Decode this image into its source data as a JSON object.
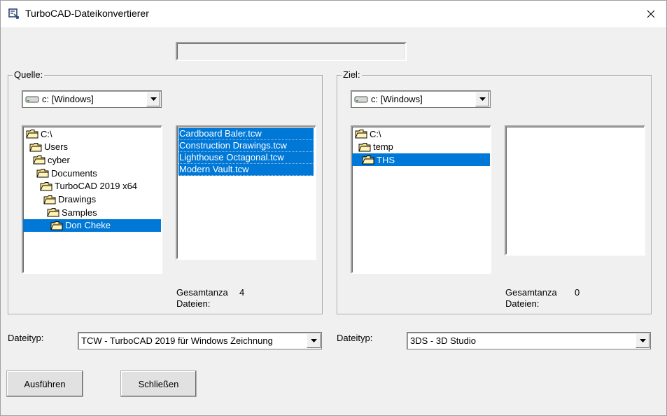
{
  "window": {
    "title": "TurboCAD-Dateikonvertierer"
  },
  "source": {
    "label": "Quelle:",
    "drive": "c: [Windows]",
    "folders": [
      {
        "name": "C:\\",
        "level": 0,
        "selected": false
      },
      {
        "name": "Users",
        "level": 1,
        "selected": false
      },
      {
        "name": "cyber",
        "level": 2,
        "selected": false
      },
      {
        "name": "Documents",
        "level": 3,
        "selected": false
      },
      {
        "name": "TurboCAD 2019 x64",
        "level": 4,
        "selected": false
      },
      {
        "name": "Drawings",
        "level": 5,
        "selected": false
      },
      {
        "name": "Samples",
        "level": 6,
        "selected": false
      },
      {
        "name": "Don Cheke",
        "level": 7,
        "selected": true
      }
    ],
    "files": [
      "Cardboard Baler.tcw",
      "Construction Drawings.tcw",
      "Lighthouse Octagonal.tcw",
      "Modern Vault.tcw"
    ],
    "total_label_1": "Gesamtanza",
    "total_label_2": "Dateien:",
    "total_count": "4",
    "filetype_label": "Dateityp:",
    "filetype": "TCW  - TurboCAD 2019 für Windows Zeichnung"
  },
  "target": {
    "label": "Ziel:",
    "drive": "c: [Windows]",
    "folders": [
      {
        "name": "C:\\",
        "level": 0,
        "selected": false
      },
      {
        "name": "temp",
        "level": 1,
        "selected": false
      },
      {
        "name": "THS",
        "level": 2,
        "selected": true
      }
    ],
    "files": [],
    "total_label_1": "Gesamtanza",
    "total_label_2": "Dateien:",
    "total_count": "0",
    "filetype_label": "Dateityp:",
    "filetype": "3DS  - 3D Studio"
  },
  "buttons": {
    "execute": "Ausführen",
    "close": "Schließen"
  },
  "colors": {
    "selection": "#0078d7",
    "window_bg": "#f0f0f0"
  }
}
